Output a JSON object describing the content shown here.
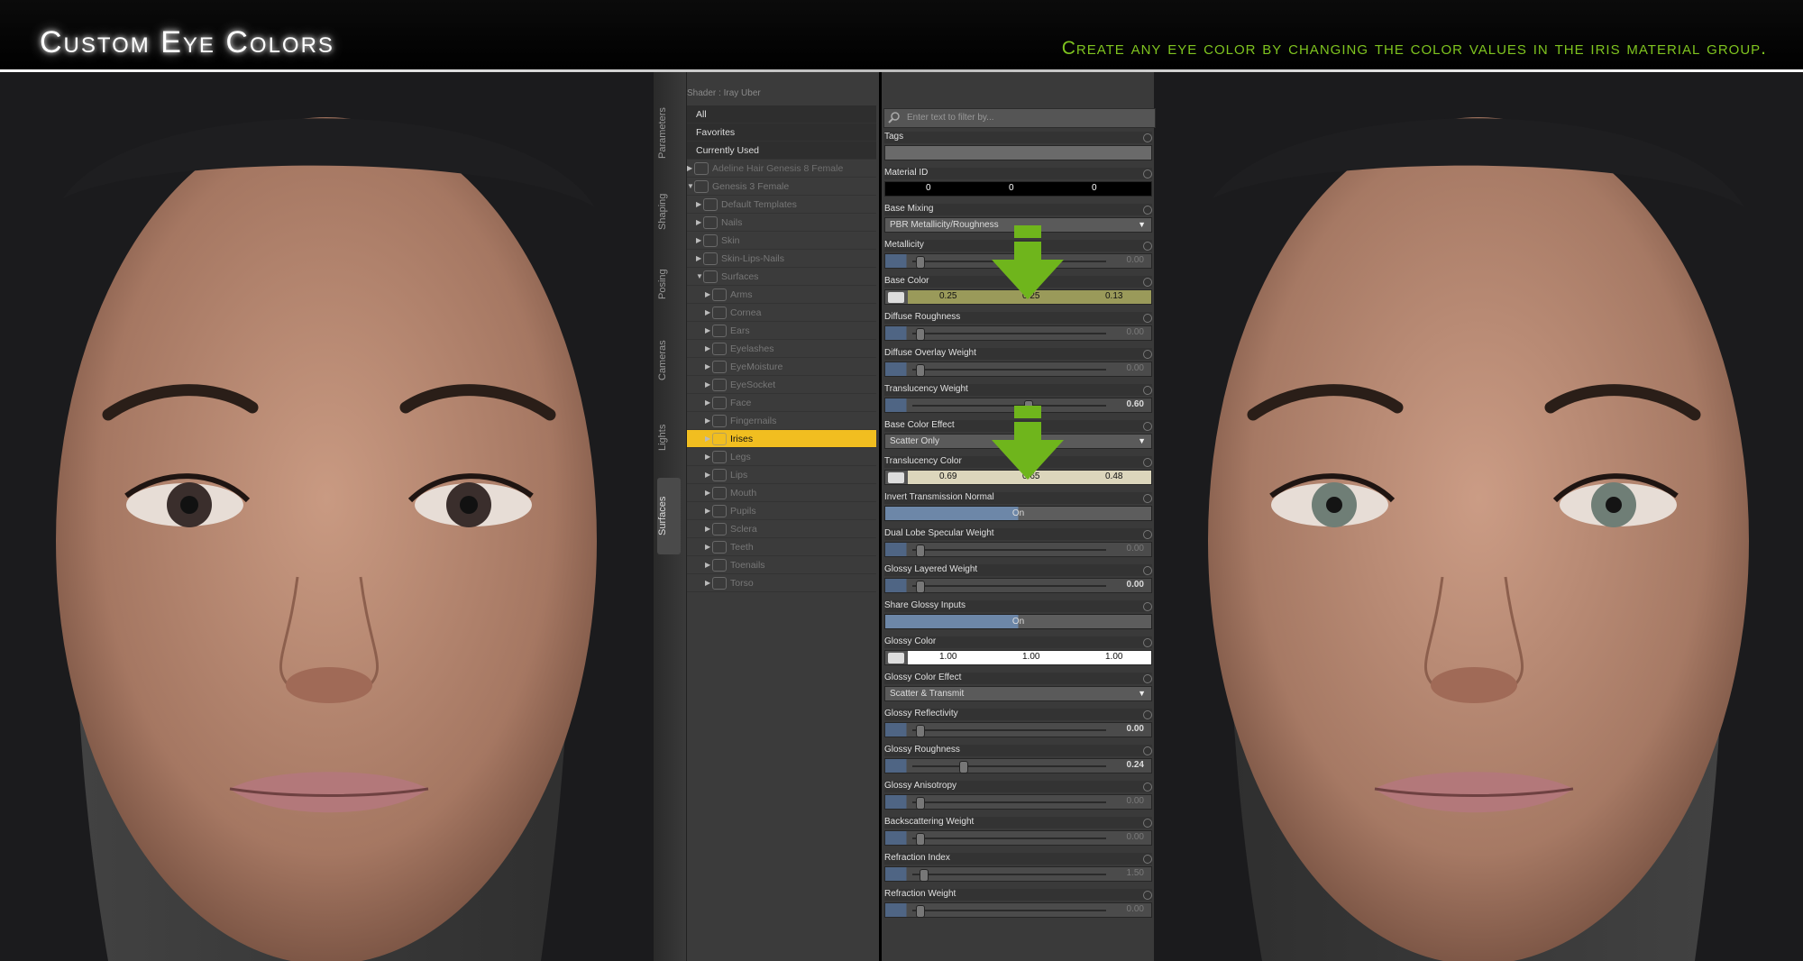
{
  "banner": {
    "title": "Custom Eye Colors",
    "tagline": "Create any eye color by changing the color values in the iris material group."
  },
  "tabs": [
    "Parameters",
    "Shaping",
    "Posing",
    "Cameras",
    "Lights",
    "Surfaces"
  ],
  "active_tab": "Surfaces",
  "shader_label": "Shader : Iray Uber",
  "filter_placeholder": "Enter text to filter by...",
  "tree": [
    {
      "label": "All",
      "kind": "hdr"
    },
    {
      "label": "Favorites",
      "kind": "hdr"
    },
    {
      "label": "Currently Used",
      "kind": "hdr"
    },
    {
      "label": "Adeline Hair Genesis 8 Female",
      "kind": "figure"
    },
    {
      "label": "Genesis 3 Female",
      "kind": "figure-open"
    },
    {
      "label": "Default Templates",
      "kind": "group"
    },
    {
      "label": "Nails",
      "kind": "group"
    },
    {
      "label": "Skin",
      "kind": "group"
    },
    {
      "label": "Skin-Lips-Nails",
      "kind": "group"
    },
    {
      "label": "Surfaces",
      "kind": "group-open"
    },
    {
      "label": "Arms",
      "kind": "item"
    },
    {
      "label": "Cornea",
      "kind": "item"
    },
    {
      "label": "Ears",
      "kind": "item"
    },
    {
      "label": "Eyelashes",
      "kind": "item"
    },
    {
      "label": "EyeMoisture",
      "kind": "item"
    },
    {
      "label": "EyeSocket",
      "kind": "item"
    },
    {
      "label": "Face",
      "kind": "item"
    },
    {
      "label": "Fingernails",
      "kind": "item"
    },
    {
      "label": "Irises",
      "kind": "selected"
    },
    {
      "label": "Legs",
      "kind": "item"
    },
    {
      "label": "Lips",
      "kind": "item"
    },
    {
      "label": "Mouth",
      "kind": "item"
    },
    {
      "label": "Pupils",
      "kind": "item"
    },
    {
      "label": "Sclera",
      "kind": "item"
    },
    {
      "label": "Teeth",
      "kind": "item"
    },
    {
      "label": "Toenails",
      "kind": "item"
    },
    {
      "label": "Torso",
      "kind": "item"
    }
  ],
  "properties": [
    {
      "label": "Tags",
      "type": "text"
    },
    {
      "label": "Material ID",
      "type": "triple",
      "values": [
        "0",
        "0",
        "0"
      ]
    },
    {
      "label": "Base Mixing",
      "type": "dropdown",
      "value": "PBR Metallicity/Roughness"
    },
    {
      "label": "Metallicity",
      "type": "slider",
      "value": "0.00",
      "level": 0.0
    },
    {
      "label": "Base Color",
      "type": "color",
      "values": [
        "0.25",
        "0.25",
        "0.13"
      ],
      "swatch": "#9a9a5a"
    },
    {
      "label": "Diffuse Roughness",
      "type": "slider",
      "value": "0.00",
      "level": 0.0
    },
    {
      "label": "Diffuse Overlay Weight",
      "type": "slider",
      "value": "0.00",
      "level": 0.0
    },
    {
      "label": "Translucency Weight",
      "type": "slider",
      "value": "0.60",
      "level": 0.6,
      "bright": true
    },
    {
      "label": "Base Color Effect",
      "type": "dropdown",
      "value": "Scatter Only"
    },
    {
      "label": "Translucency Color",
      "type": "color",
      "values": [
        "0.69",
        "0.65",
        "0.48"
      ],
      "swatch": "#dcd6bc"
    },
    {
      "label": "Invert Transmission Normal",
      "type": "toggle",
      "value": "On"
    },
    {
      "label": "Dual Lobe Specular Weight",
      "type": "slider",
      "value": "0.00",
      "level": 0.0
    },
    {
      "label": "Glossy Layered Weight",
      "type": "slider",
      "value": "0.00",
      "level": 0.0,
      "bright": true
    },
    {
      "label": "Share Glossy Inputs",
      "type": "toggle",
      "value": "On"
    },
    {
      "label": "Glossy Color",
      "type": "color",
      "values": [
        "1.00",
        "1.00",
        "1.00"
      ],
      "swatch": "#ffffff"
    },
    {
      "label": "Glossy Color Effect",
      "type": "dropdown",
      "value": "Scatter & Transmit"
    },
    {
      "label": "Glossy Reflectivity",
      "type": "slider",
      "value": "0.00",
      "level": 0.0,
      "bright": true
    },
    {
      "label": "Glossy Roughness",
      "type": "slider",
      "value": "0.24",
      "level": 0.24,
      "bright": true
    },
    {
      "label": "Glossy Anisotropy",
      "type": "slider",
      "value": "0.00",
      "level": 0.0
    },
    {
      "label": "Backscattering Weight",
      "type": "slider",
      "value": "0.00",
      "level": 0.0
    },
    {
      "label": "Refraction Index",
      "type": "slider",
      "value": "1.50",
      "level": 0.02
    },
    {
      "label": "Refraction Weight",
      "type": "slider",
      "value": "0.00",
      "level": 0.0
    }
  ],
  "colors": {
    "accent_green": "#7fc41f",
    "selected_yellow": "#f1be20"
  }
}
